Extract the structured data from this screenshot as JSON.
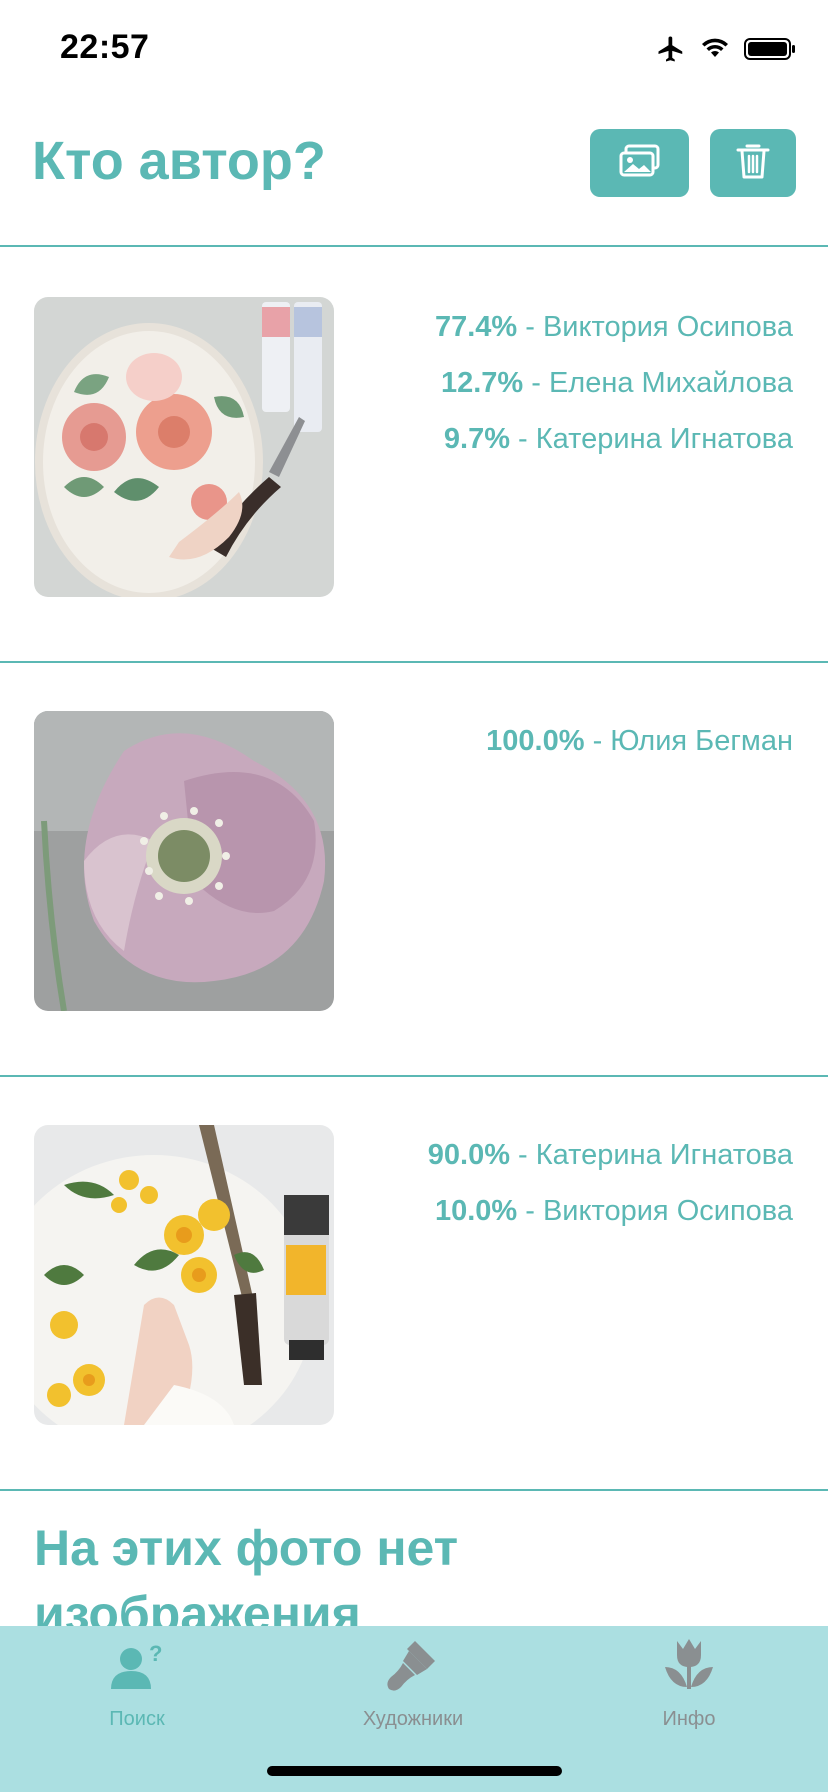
{
  "status_bar": {
    "time": "22:57",
    "icons": [
      "airplane-icon",
      "wifi-icon",
      "battery-icon"
    ]
  },
  "header": {
    "title": "Кто автор?",
    "buttons": [
      "gallery-icon",
      "trash-icon"
    ]
  },
  "results": [
    {
      "guesses": [
        {
          "percent": "77.4%",
          "name": " - Виктория Осипова"
        },
        {
          "percent": "12.7%",
          "name": " - Елена Михайлова"
        },
        {
          "percent": "9.7%",
          "name": " - Катерина Игнатова"
        }
      ]
    },
    {
      "guesses": [
        {
          "percent": "100.0%",
          "name": " - Юлия Бегман"
        }
      ]
    },
    {
      "guesses": [
        {
          "percent": "90.0%",
          "name": " - Катерина Игнатова"
        },
        {
          "percent": "10.0%",
          "name": " - Виктория Осипова"
        }
      ]
    }
  ],
  "no_image_section": {
    "title": "На этих фото нет изображения"
  },
  "tab_bar": {
    "tabs": [
      {
        "label": "Поиск",
        "icon": "person-question-icon",
        "active": true
      },
      {
        "label": "Художники",
        "icon": "brush-icon",
        "active": false
      },
      {
        "label": "Инфо",
        "icon": "tulip-icon",
        "active": false
      }
    ]
  },
  "colors": {
    "accent": "#5bb8b4",
    "tab_bar_bg": "#abdfe1",
    "inactive": "#8a8f91"
  }
}
